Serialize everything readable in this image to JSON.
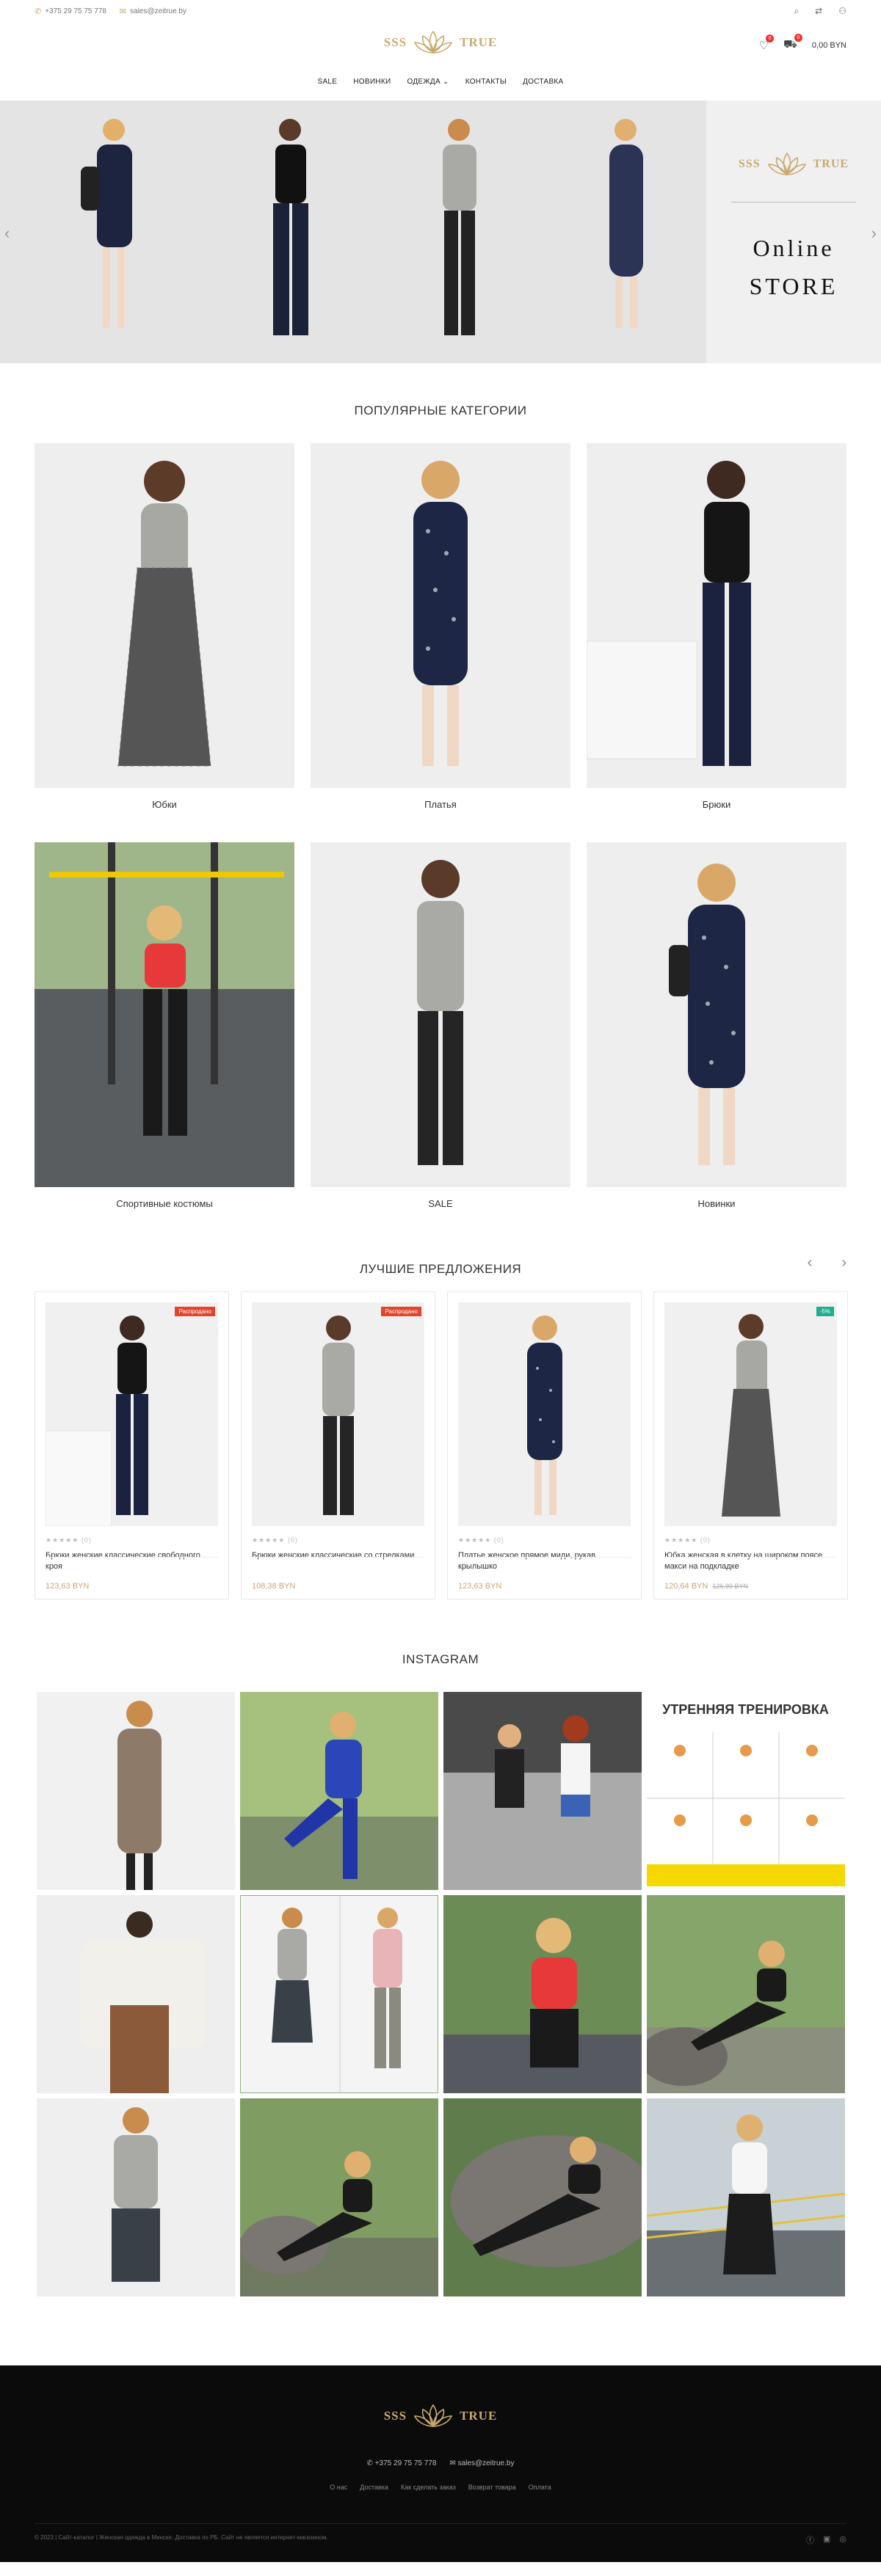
{
  "topbar": {
    "phone": "+375 29 75 75 778",
    "email": "sales@zeitrue.by"
  },
  "header": {
    "logo_left": "SSS",
    "logo_right": "TRUE",
    "wishlist_count": "0",
    "cart_count": "0",
    "cart_total": "0,00 BYN"
  },
  "nav": [
    "SALE",
    "НОВИНКИ",
    "ОДЕЖДА",
    "КОНТАКТЫ",
    "ДОСТАВКА"
  ],
  "hero": {
    "logo_left": "SSS",
    "logo_right": "TRUE",
    "line1": "Online",
    "line2": "STORE"
  },
  "categories": {
    "title": "ПОПУЛЯРНЫЕ КАТЕГОРИИ",
    "items": [
      "Юбки",
      "Платья",
      "Брюки",
      "Спортивные костюмы",
      "SALE",
      "Новинки"
    ]
  },
  "offers": {
    "title": "ЛУЧШИЕ ПРЕДЛОЖЕНИЯ",
    "items": [
      {
        "tag": "Распродано",
        "name": "Брюки женские классические свободного кроя",
        "price": "123,63 BYN",
        "old": "",
        "reviews": "(0)"
      },
      {
        "tag": "Распродано",
        "name": "Брюки женские классические со стрелками",
        "price": "108,38 BYN",
        "old": "",
        "reviews": "(0)"
      },
      {
        "tag": "",
        "name": "Платье женское прямое миди, рукав крылышко",
        "price": "123,63 BYN",
        "old": "",
        "reviews": "(0)"
      },
      {
        "tag": "-5%",
        "name": "Юбка женская в клетку на широком поясе макси на подкладке",
        "price": "120,64 BYN",
        "old": "126,99 BYN",
        "reviews": "(0)"
      }
    ]
  },
  "instagram": {
    "title": "INSTAGRAM",
    "poster_text": "УТРЕННЯЯ ТРЕНИРОВКА"
  },
  "footer": {
    "logo_left": "SSS",
    "logo_right": "TRUE",
    "phone": "+375 29 75 75 778",
    "email": "sales@zeitrue.by",
    "links": [
      "О нас",
      "Доставка",
      "Как сделать заказ",
      "Возврат товара",
      "Оплата"
    ],
    "copyright": "© 2023 | Сайт-каталог | Женская одежда в Минске. Доставка по РБ. Сайт не является интернет-магазином."
  },
  "colors": {
    "accent": "#c9a96e",
    "sale": "#e2452b",
    "discount": "#1fae8b",
    "footer_bg": "#0b0b0b"
  }
}
